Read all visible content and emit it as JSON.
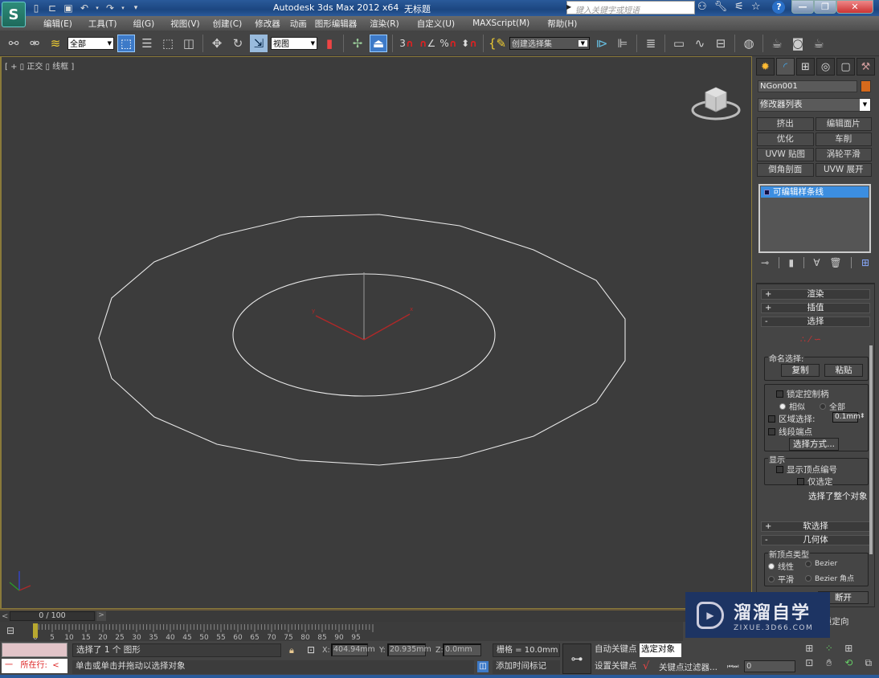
{
  "titlebar": {
    "app_title": "Autodesk 3ds Max  2012 x64",
    "doc_title": "无标题",
    "search_placeholder": "键入关键字或短语",
    "logo_glyph": "S",
    "quick_access_icons": [
      "new-file-icon",
      "open-file-icon",
      "save-icon",
      "undo-icon",
      "redo-icon",
      "customize-dropdown-icon"
    ],
    "right_icons": [
      "binoculars-icon",
      "wrench-icon",
      "satellite-icon",
      "star-icon",
      "help-icon"
    ],
    "window_buttons": [
      "minimize",
      "restore",
      "close"
    ]
  },
  "menubar": {
    "items": [
      "编辑(E)",
      "工具(T)",
      "组(G)",
      "视图(V)",
      "创建(C)",
      "修改器",
      "动画",
      "图形编辑器",
      "渲染(R)",
      "自定义(U)",
      "MAXScript(M)",
      "帮助(H)"
    ]
  },
  "toolbar": {
    "selection_filter": "全部",
    "ref_coord": "视图",
    "named_selection": "创建选择集",
    "icons": [
      "link-icon",
      "unlink-icon",
      "bind-spacewarp-icon",
      "select-object-icon",
      "select-by-name-icon",
      "rect-selection-icon",
      "window-crossing-icon",
      "move-icon",
      "rotate-icon",
      "scale-icon",
      "pivot-icon",
      "manipulate-icon",
      "keyboard-shortcut-icon",
      "snap-3-icon",
      "angle-snap-icon",
      "percent-snap-icon",
      "spinner-snap-icon",
      "edit-named-sel-icon",
      "mirror-icon",
      "align-icon",
      "layer-manager-icon",
      "graphite-icon",
      "curve-editor-icon",
      "schematic-icon",
      "material-editor-icon",
      "render-setup-icon",
      "rendered-frame-icon",
      "render-icon"
    ],
    "snap_labels": [
      "3",
      "",
      "%",
      ""
    ]
  },
  "viewport": {
    "label": "[ + ] 正交 ] 线框 ]",
    "label_display": "[ + ▯ 正交 ▯ 线框 ]",
    "axis_labels": {
      "x": "x",
      "y": "y",
      "z": "z"
    },
    "colors": {
      "background": "#3c3c3c",
      "spline": "#e8e8e8",
      "gizmo": "#b02828"
    }
  },
  "command_panel": {
    "tabs": [
      "create-tab",
      "modify-tab",
      "hierarchy-tab",
      "motion-tab",
      "display-tab",
      "utilities-tab"
    ],
    "object_name": "NGon001",
    "object_color": "#d66a1c",
    "modifier_list": "修改器列表",
    "modifier_buttons": [
      "挤出",
      "编辑面片",
      "优化",
      "车削",
      "UVW 贴图",
      "涡轮平滑",
      "倒角剖面",
      "UVW 展开"
    ],
    "stack_items": [
      "可编辑样条线"
    ],
    "rollouts": {
      "render": "渲染",
      "interpolation": "插值",
      "selection": "选择",
      "soft_selection": "软选择",
      "geometry": "几何体"
    },
    "selection": {
      "named_sel_title": "命名选择:",
      "copy": "复制",
      "paste": "粘贴",
      "lock_handles": "锁定控制柄",
      "alike": "相似",
      "all": "全部",
      "area_select": "区域选择:",
      "area_value": "0.1mm",
      "segment_end": "线段端点",
      "select_by": "选择方式...",
      "display_title": "显示",
      "show_vertex_numbers": "显示顶点编号",
      "selected_only": "仅选定",
      "status": "选择了整个对象"
    },
    "geometry": {
      "new_vertex_type": "新顶点类型",
      "linear": "线性",
      "bezier": "Bezier",
      "smooth": "平滑",
      "bezier_corner": "Bezier 角点",
      "break": "断开",
      "reorient": "重定向"
    }
  },
  "timeline": {
    "slider_text": "0 / 100",
    "prev": "<",
    "next": ">",
    "ticks": [
      "0",
      "5",
      "10",
      "15",
      "20",
      "25",
      "30",
      "35",
      "40",
      "45",
      "50",
      "55",
      "60",
      "65",
      "70",
      "75",
      "80",
      "85",
      "90",
      "95"
    ],
    "current_frame": 0,
    "total_frames": 100
  },
  "statusbar": {
    "listener_text": "所在行:",
    "listener_prefix": "一",
    "listener_arrow": "<",
    "status_line1": "选择了 1 个 图形",
    "status_line2": "单击或单击并拖动以选择对象",
    "x_label": "X:",
    "x_value": "404.94mm",
    "y_label": "Y:",
    "y_value": "20.935mm",
    "z_label": "Z:",
    "z_value": "0.0mm",
    "grid": "栅格 = 10.0mm",
    "add_time_tag": "添加时间标记",
    "auto_key": "自动关键点",
    "set_key": "设置关键点",
    "selected_set": "选定对象",
    "key_filters": "关键点过滤器...",
    "frame_value": "0"
  },
  "watermark": {
    "title": "溜溜自学",
    "url": "ZIXUE.3D66.COM"
  }
}
